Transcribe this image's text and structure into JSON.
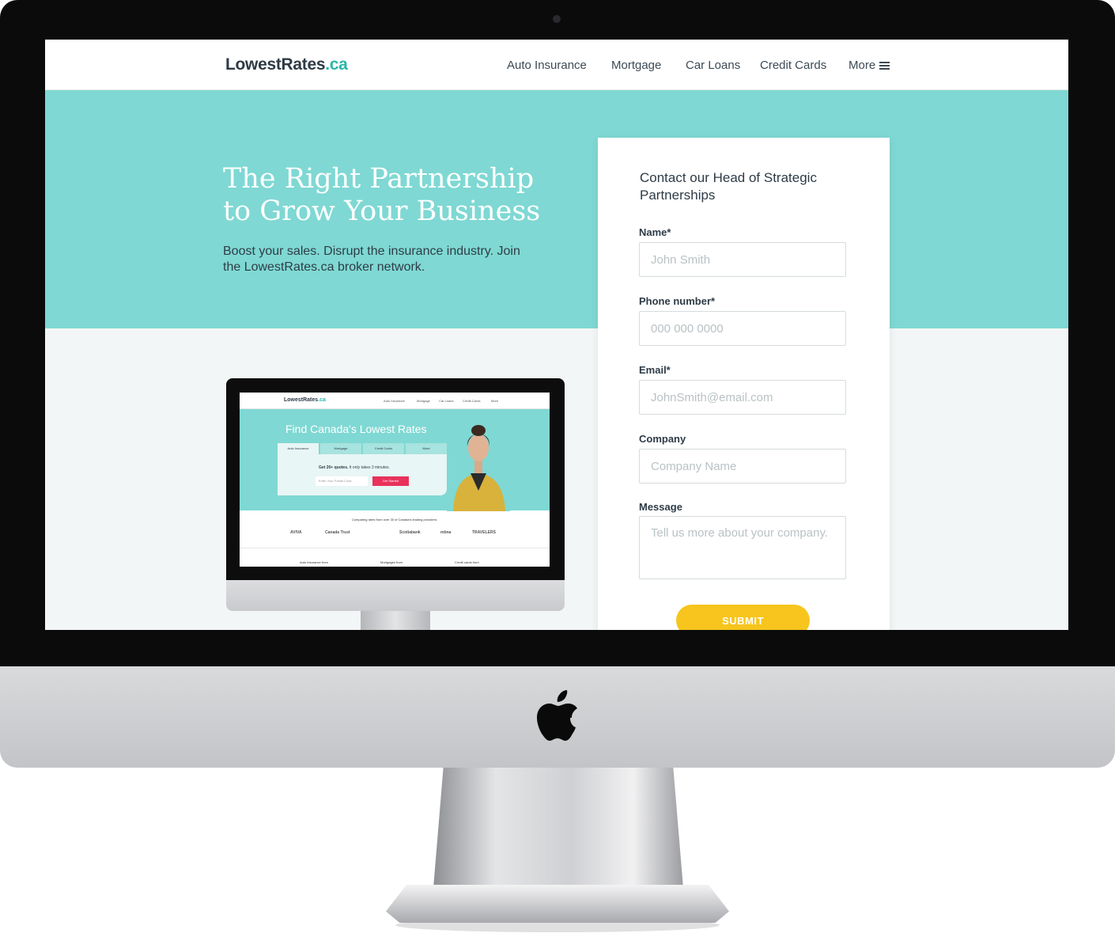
{
  "nav": {
    "logo_main": "LowestRates",
    "logo_tld": ".ca",
    "links": [
      "Auto Insurance",
      "Mortgage",
      "Car Loans",
      "Credit Cards",
      "More"
    ],
    "menu_icon": "hamburger-icon"
  },
  "hero": {
    "title_line1": "The Right Partnership",
    "title_line2": "to Grow Your Business",
    "subtitle_line1": "Boost your sales. Disrupt the insurance industry. Join",
    "subtitle_line2": "the LowestRates.ca broker network."
  },
  "form": {
    "title_line1": "Contact our Head of Strategic",
    "title_line2": "Partnerships",
    "fields": [
      {
        "label": "Name*",
        "placeholder": "John Smith"
      },
      {
        "label": "Phone number*",
        "placeholder": "000 000 0000"
      },
      {
        "label": "Email*",
        "placeholder": "JohnSmith@email.com"
      },
      {
        "label": "Company",
        "placeholder": "Company Name"
      },
      {
        "label": "Message",
        "placeholder": "Tell us more about your company."
      }
    ],
    "submit_label": "SUBMIT"
  },
  "mini": {
    "logo_main": "LowestRates",
    "logo_tld": ".ca",
    "links": [
      "Auto Insurance",
      "Mortgage",
      "Car Loans",
      "Credit Cards",
      "More"
    ],
    "title": "Find Canada's Lowest Rates",
    "tabs": [
      "Auto Insurance",
      "Mortgage",
      "Credit Cards",
      "More"
    ],
    "quotes_bold": "Get 20+ quotes.",
    "quotes_rest": " It only takes 3 minutes.",
    "postal_placeholder": "Enter Your Postal Code",
    "button": "Get Started",
    "compare": "Comparing rates from over 30 of Canada's leading providers:",
    "providers": [
      "AVIVA",
      "Canada Trust",
      "Scotiabank",
      "mbna",
      "TRAVELERS"
    ],
    "footer": [
      "Auto insurance from",
      "Mortgages from",
      "Credit cards from"
    ]
  },
  "colors": {
    "teal": "#7fd8d3",
    "brand_teal": "#29b6a8",
    "submit_yellow": "#f7c51d",
    "cta_pink": "#e9315b",
    "text_dark": "#2e3b46"
  },
  "icons": {
    "device_logo": "apple-logo-icon"
  }
}
